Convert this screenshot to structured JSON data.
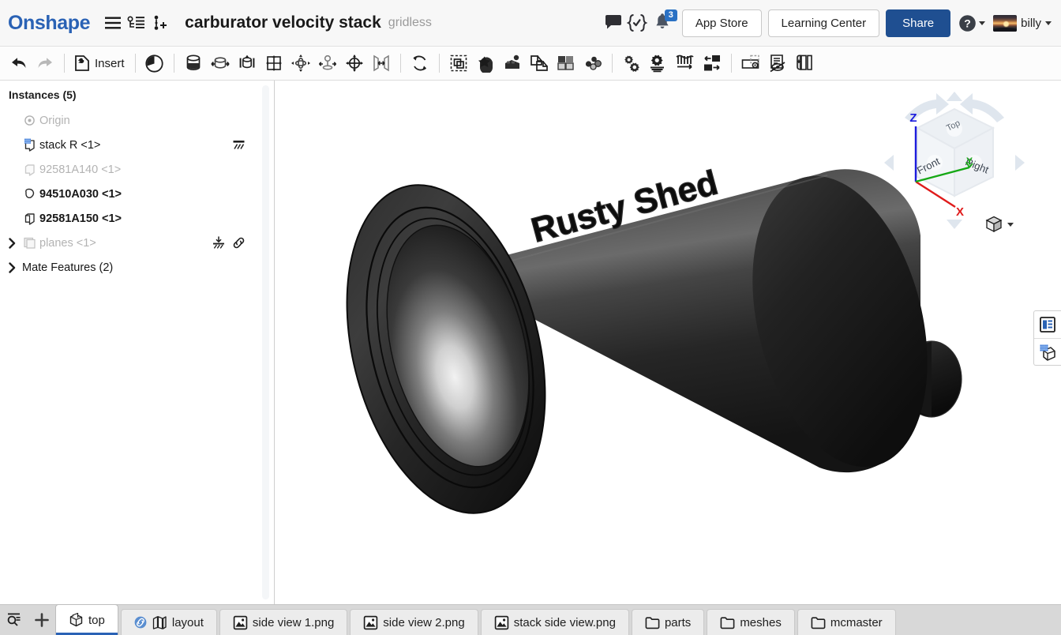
{
  "header": {
    "brand": "Onshape",
    "menu_icon": "hamburger-icon",
    "tree_icon": "document-tree-icon",
    "insert_version_icon": "add-version-icon",
    "title": "carburator velocity stack",
    "subtitle": "gridless",
    "comment_icon": "comment-icon",
    "checks_icon": "braces-check-icon",
    "bell_icon": "notification-bell-icon",
    "notification_count": "3",
    "app_store_label": "App Store",
    "learning_center_label": "Learning Center",
    "share_label": "Share",
    "help_icon": "help-question-icon",
    "user_name": "billy",
    "accent_blue": "#2a62b5",
    "share_blue": "#1f4f91",
    "badge_blue": "#2a71c4"
  },
  "toolbar": {
    "items": [
      {
        "name": "undo-icon",
        "label": ""
      },
      {
        "name": "redo-icon",
        "label": ""
      },
      {
        "name": "insert-icon",
        "label": "Insert"
      },
      {
        "name": "history-clock-icon",
        "label": ""
      },
      {
        "name": "fix-component-icon",
        "label": ""
      },
      {
        "name": "revolute-mate-icon",
        "label": ""
      },
      {
        "name": "slider-mate-icon",
        "label": ""
      },
      {
        "name": "planar-mate-icon",
        "label": ""
      },
      {
        "name": "ball-mate-icon",
        "label": ""
      },
      {
        "name": "pin-slot-mate-icon",
        "label": ""
      },
      {
        "name": "cylindrical-mate-icon",
        "label": ""
      },
      {
        "name": "parallel-mate-icon",
        "label": ""
      },
      {
        "name": "transform-icon",
        "label": ""
      },
      {
        "name": "group-icon",
        "label": ""
      },
      {
        "name": "mate-connector-icon",
        "label": ""
      },
      {
        "name": "replicate-icon",
        "label": ""
      },
      {
        "name": "copy-part-icon",
        "label": ""
      },
      {
        "name": "assembly-pattern-icon",
        "label": ""
      },
      {
        "name": "exploded-view-icon",
        "label": ""
      },
      {
        "name": "configure-gears-icon",
        "label": ""
      },
      {
        "name": "gear-settings-icon",
        "label": ""
      },
      {
        "name": "spring-icon",
        "label": ""
      },
      {
        "name": "move-instance-icon",
        "label": ""
      },
      {
        "name": "display-state-icon",
        "label": ""
      },
      {
        "name": "hide-show-icon",
        "label": ""
      },
      {
        "name": "section-view-icon",
        "label": ""
      }
    ],
    "insert_label": "Insert"
  },
  "sidebar": {
    "panel_title": "Instances (5)",
    "nodes": [
      {
        "label": "Origin",
        "icon": "origin-icon",
        "muted": true,
        "twisty": false,
        "actions": []
      },
      {
        "label": "stack R <1>",
        "icon": "part-sketch-icon",
        "muted": false,
        "twisty": false,
        "actions": [
          "fixed-icon"
        ]
      },
      {
        "label": "92581A140 <1>",
        "icon": "part-icon",
        "muted": true,
        "twisty": false,
        "actions": []
      },
      {
        "label": "94510A030 <1>",
        "icon": "washer-part-icon",
        "muted": false,
        "twisty": false,
        "actions": []
      },
      {
        "label": "92581A150 <1>",
        "icon": "part-icon",
        "muted": false,
        "twisty": false,
        "actions": []
      },
      {
        "label": "planes <1>",
        "icon": "planes-icon",
        "muted": true,
        "twisty": true,
        "actions": [
          "grounded-icon",
          "link-icon"
        ]
      },
      {
        "label": "Mate Features (2)",
        "icon": "",
        "muted": false,
        "twisty": true,
        "actions": [],
        "bold": false
      }
    ]
  },
  "viewport": {
    "model_text": "Rusty Shed",
    "model_color": "#1e1e1e",
    "background": "#ffffff",
    "viewcube": {
      "face_top": "Top",
      "face_front": "Front",
      "face_right": "Right",
      "axis_x": "X",
      "axis_y": "Y",
      "axis_z": "Z",
      "axis_x_color": "#e01b1b",
      "axis_y_color": "#15a815",
      "axis_z_color": "#1b1bdd",
      "view_menu_icon": "view-cube-icon",
      "view_menu_caret": "chevron-down-icon"
    },
    "right_dock": [
      {
        "name": "panel-list-icon"
      },
      {
        "name": "sketch-cube-icon"
      }
    ]
  },
  "tabbar": {
    "search_icon": "tab-search-icon",
    "add_icon": "add-tab-icon",
    "tabs": [
      {
        "label": "top",
        "icon": "assembly-cube-icon",
        "active": true,
        "linked": false
      },
      {
        "label": "layout",
        "icon": "part-studio-icon",
        "active": false,
        "linked": true
      },
      {
        "label": "side view 1.png",
        "icon": "image-icon",
        "active": false,
        "linked": false
      },
      {
        "label": "side view 2.png",
        "icon": "image-icon",
        "active": false,
        "linked": false
      },
      {
        "label": "stack side view.png",
        "icon": "image-icon",
        "active": false,
        "linked": false
      },
      {
        "label": "parts",
        "icon": "folder-icon",
        "active": false,
        "linked": false
      },
      {
        "label": "meshes",
        "icon": "folder-icon",
        "active": false,
        "linked": false
      },
      {
        "label": "mcmaster",
        "icon": "folder-icon",
        "active": false,
        "linked": false
      }
    ]
  }
}
